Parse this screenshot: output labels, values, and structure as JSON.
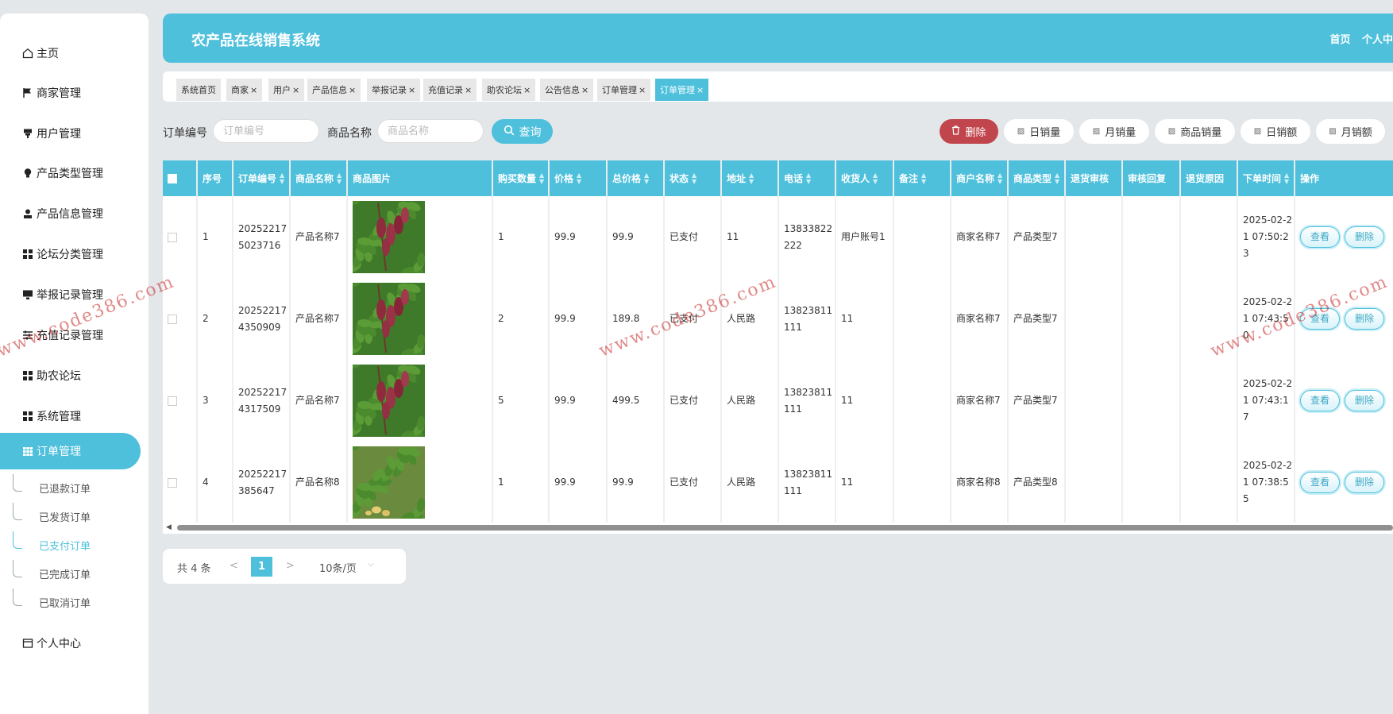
{
  "app": {
    "title": "农产品在线销售系统"
  },
  "header": {
    "links": [
      "首页",
      "个人中"
    ]
  },
  "sidebar": {
    "items": [
      {
        "label": "主页",
        "icon": "home-icon"
      },
      {
        "label": "商家管理",
        "icon": "flag-icon"
      },
      {
        "label": "用户管理",
        "icon": "user-icon"
      },
      {
        "label": "产品类型管理",
        "icon": "bulb-icon"
      },
      {
        "label": "产品信息管理",
        "icon": "person-icon"
      },
      {
        "label": "论坛分类管理",
        "icon": "grid-icon"
      },
      {
        "label": "举报记录管理",
        "icon": "monitor-icon"
      },
      {
        "label": "充值记录管理",
        "icon": "sliders-icon"
      },
      {
        "label": "助农论坛",
        "icon": "grid-icon"
      },
      {
        "label": "系统管理",
        "icon": "grid-icon"
      },
      {
        "label": "订单管理",
        "icon": "table-icon"
      }
    ],
    "submenu": [
      "已退款订单",
      "已发货订单",
      "已支付订单",
      "已完成订单",
      "已取消订单"
    ],
    "personal": {
      "label": "个人中心",
      "icon": "window-icon"
    }
  },
  "tabs": [
    "系统首页",
    "商家",
    "用户",
    "产品信息",
    "举报记录",
    "充值记录",
    "助农论坛",
    "公告信息",
    "订单管理",
    "订单管理"
  ],
  "tab_close": "×",
  "search": {
    "order_no_label": "订单编号",
    "order_no_placeholder": "订单编号",
    "product_name_label": "商品名称",
    "product_name_placeholder": "商品名称",
    "query_label": "查询"
  },
  "actions": [
    "删除",
    "日销量",
    "月销量",
    "商品销量",
    "日销额",
    "月销额"
  ],
  "table": {
    "headers": [
      "序号",
      "订单编号",
      "商品名称",
      "商品图片",
      "购买数量",
      "价格",
      "总价格",
      "状态",
      "地址",
      "电话",
      "收货人",
      "备注",
      "商户名称",
      "商品类型",
      "退货审核",
      "审核回复",
      "退货原因",
      "下单时间",
      "操作"
    ],
    "rows": [
      {
        "idx": "1",
        "order_no": "202522175023716",
        "name": "产品名称7",
        "qty": "1",
        "price": "99.9",
        "total": "99.9",
        "status": "已支付",
        "addr": "11",
        "phone": "13833822222",
        "receiver": "用户账号1",
        "note": "",
        "merchant": "商家名称7",
        "type": "产品类型7",
        "rv": "",
        "rp": "",
        "rr": "",
        "time": "2025-02-21 07:50:23"
      },
      {
        "idx": "2",
        "order_no": "202522174350909",
        "name": "产品名称7",
        "qty": "2",
        "price": "99.9",
        "total": "189.8",
        "status": "已支付",
        "addr": "人民路",
        "phone": "13823811111",
        "receiver": "11",
        "note": "",
        "merchant": "商家名称7",
        "type": "产品类型7",
        "rv": "",
        "rp": "",
        "rr": "",
        "time": "2025-02-21 07:43:50"
      },
      {
        "idx": "3",
        "order_no": "202522174317509",
        "name": "产品名称7",
        "qty": "5",
        "price": "99.9",
        "total": "499.5",
        "status": "已支付",
        "addr": "人民路",
        "phone": "13823811111",
        "receiver": "11",
        "note": "",
        "merchant": "商家名称7",
        "type": "产品类型7",
        "rv": "",
        "rp": "",
        "rr": "",
        "time": "2025-02-21 07:43:17"
      },
      {
        "idx": "4",
        "order_no": "20252217385647",
        "name": "产品名称8",
        "qty": "1",
        "price": "99.9",
        "total": "99.9",
        "status": "已支付",
        "addr": "人民路",
        "phone": "13823811111",
        "receiver": "11",
        "note": "",
        "merchant": "商家名称8",
        "type": "产品类型8",
        "rv": "",
        "rp": "",
        "rr": "",
        "time": "2025-02-21 07:38:55"
      }
    ],
    "view_label": "查看",
    "delete_label": "删除"
  },
  "pagination": {
    "total": "共 4 条",
    "prev": "<",
    "current": "1",
    "next": ">",
    "page_size": "10条/页"
  },
  "watermark": "www.code386.com",
  "colors": {
    "accent": "#4ec0dc",
    "danger": "#c1454c",
    "background": "#e3e7ea"
  }
}
